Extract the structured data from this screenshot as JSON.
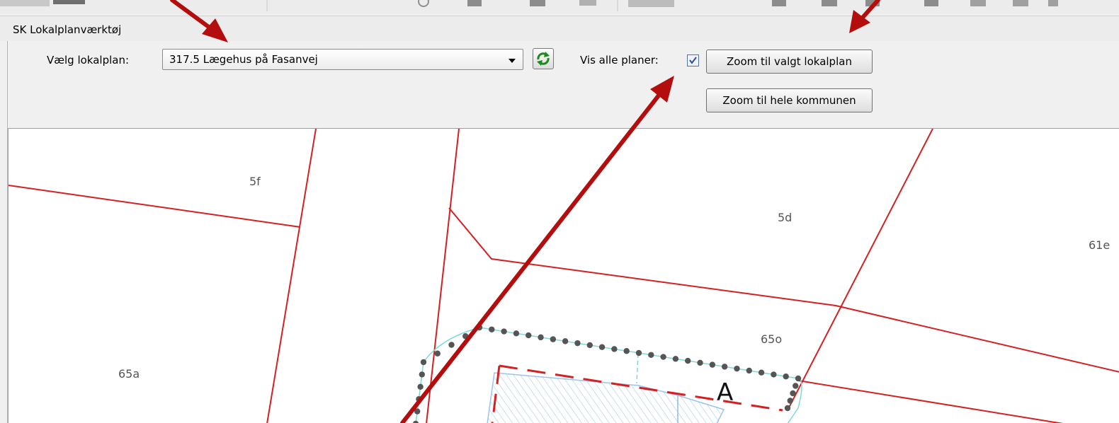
{
  "panel": {
    "title": "SK Lokalplanværktøj"
  },
  "controls": {
    "plan_label": "Vælg lokalplan:",
    "plan_selected": "317.5 Lægehus på Fasanvej",
    "show_all_label": "Vis alle planer:",
    "show_all_checked": true,
    "zoom_selected_label": "Zoom til valgt lokalplan",
    "zoom_municipality_label": "Zoom til hele kommunen"
  },
  "map": {
    "parcel_labels": [
      "5f",
      "5d",
      "61e",
      "65o",
      "65a"
    ],
    "zone_label": "A"
  },
  "colors": {
    "parcel_line": "#d42020",
    "annotation_arrow": "#b30d0d",
    "plan_boundary": "#555555",
    "hatch": "#a9c8e8"
  },
  "icons": {
    "refresh": "refresh-icon",
    "dropdown": "chevron-down-icon"
  }
}
